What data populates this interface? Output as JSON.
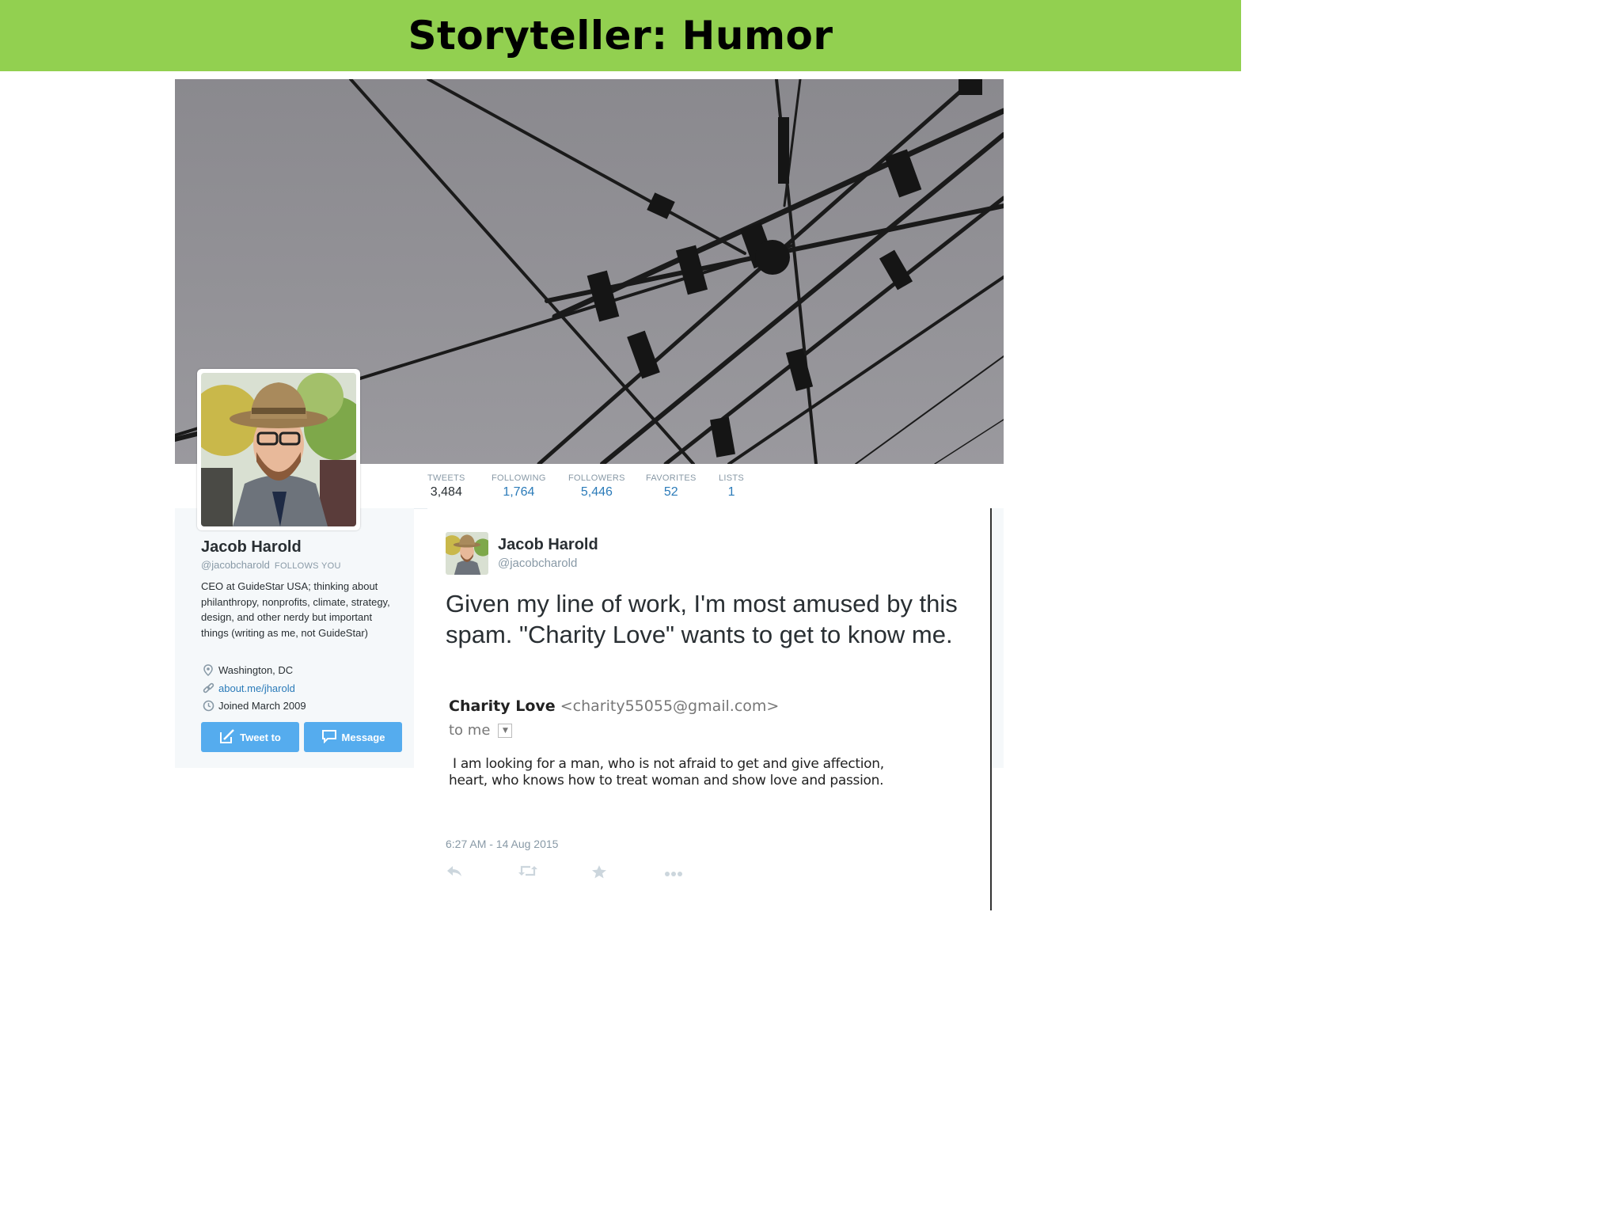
{
  "slide": {
    "title": "Storyteller: Humor"
  },
  "profile": {
    "name": "Jacob Harold",
    "handle": "@jacobcharold",
    "follows_you": "FOLLOWS YOU",
    "bio": "CEO at GuideStar USA; thinking about philanthropy, nonprofits, climate, strategy, design, and other nerdy but important things (writing as me, not GuideStar)",
    "location": "Washington, DC",
    "website": "about.me/jharold",
    "joined": "Joined March 2009",
    "buttons": {
      "tweet_to": "Tweet to",
      "message": "Message"
    }
  },
  "stats": [
    {
      "label": "TWEETS",
      "value": "3,484"
    },
    {
      "label": "FOLLOWING",
      "value": "1,764"
    },
    {
      "label": "FOLLOWERS",
      "value": "5,446"
    },
    {
      "label": "FAVORITES",
      "value": "52"
    },
    {
      "label": "LISTS",
      "value": "1"
    }
  ],
  "tweet": {
    "name": "Jacob Harold",
    "handle": "@jacobcharold",
    "text": "Given my line of work, I'm most amused by this spam. \"Charity Love\" wants to get to know me.",
    "timestamp": "6:27 AM - 14 Aug 2015",
    "email": {
      "sender_name": "Charity Love",
      "sender_address": "<charity55055@gmail.com>",
      "to": "to me",
      "body_line1": "I am looking for a man, who is not afraid to get and give affection, ",
      "body_line2": "heart, who knows how to treat woman and show love and passion."
    },
    "actions": [
      "reply-icon",
      "retweet-icon",
      "favorite-icon",
      "more-icon"
    ]
  },
  "colors": {
    "title_bar": "#92d050",
    "twitter_blue": "#55acee",
    "link_blue": "#2b7bb9",
    "muted_gray": "#8899a6",
    "panel_bg": "#f5f8fa"
  }
}
